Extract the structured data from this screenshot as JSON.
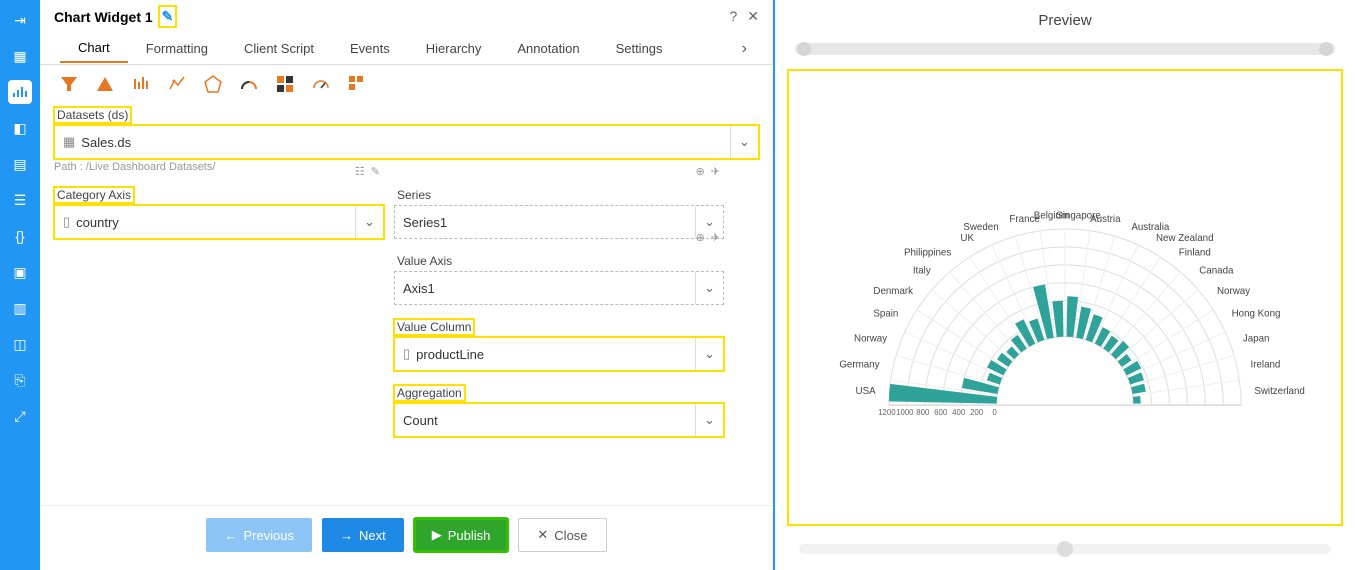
{
  "header": {
    "title": "Chart Widget 1",
    "help_icon": "?",
    "close_icon": "✕"
  },
  "tabs": [
    "Chart",
    "Formatting",
    "Client Script",
    "Events",
    "Hierarchy",
    "Annotation",
    "Settings"
  ],
  "active_tab": 0,
  "datasets": {
    "label": "Datasets (ds)",
    "value": "Sales.ds",
    "path": "Path : /Live Dashboard Datasets/"
  },
  "category_axis": {
    "label": "Category Axis",
    "value": "country"
  },
  "series": {
    "label": "Series",
    "value": "Series1"
  },
  "value_axis": {
    "label": "Value Axis",
    "value": "Axis1"
  },
  "value_column": {
    "label": "Value Column",
    "value": "productLine"
  },
  "aggregation": {
    "label": "Aggregation",
    "value": "Count"
  },
  "buttons": {
    "prev": "Previous",
    "next": "Next",
    "publish": "Publish",
    "close": "Close"
  },
  "preview": {
    "title": "Preview"
  },
  "chart_data": {
    "type": "bar",
    "subtype": "radial-bar",
    "categories": [
      "USA",
      "Germany",
      "Norway",
      "Spain",
      "Denmark",
      "Italy",
      "Philippines",
      "UK",
      "Sweden",
      "France",
      "Belgium",
      "Singapore",
      "Austria",
      "Australia",
      "New Zealand",
      "Finland",
      "Canada",
      "Norway",
      "Hong Kong",
      "Japan",
      "Ireland",
      "Switzerland"
    ],
    "values": [
      1200,
      400,
      150,
      200,
      150,
      120,
      180,
      300,
      250,
      600,
      400,
      450,
      350,
      300,
      200,
      170,
      200,
      130,
      180,
      160,
      150,
      80
    ],
    "radial_ticks": [
      200,
      400,
      600,
      800,
      1000,
      1200
    ],
    "ylim": [
      0,
      1200
    ],
    "color": "#2fa39a"
  }
}
